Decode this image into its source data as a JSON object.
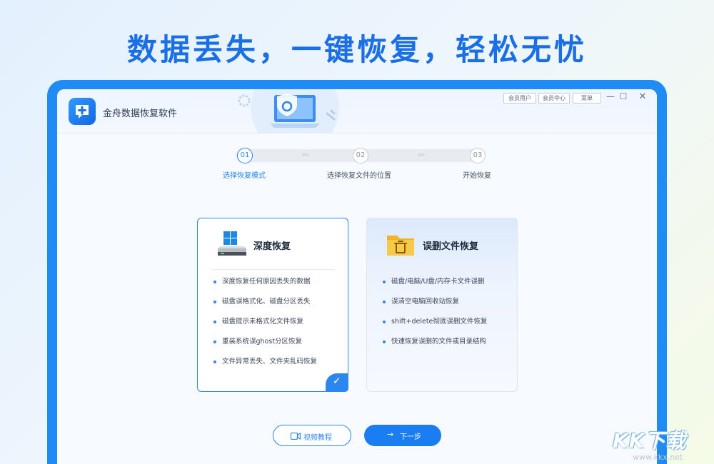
{
  "headline": "数据丢失，一键恢复，轻松无忧",
  "app": {
    "title": "金舟数据恢复软件",
    "buttons": {
      "member": "会员用户",
      "center": "会员中心",
      "menu": "菜单"
    },
    "window_controls": {
      "minimize": "—",
      "maximize": "☐",
      "close": "✕"
    }
  },
  "steps": [
    {
      "number": "01",
      "label": "选择恢复模式",
      "active": true
    },
    {
      "number": "02",
      "label": "选择恢复文件的位置",
      "active": false
    },
    {
      "number": "03",
      "label": "开始恢复",
      "active": false
    }
  ],
  "step_separator": "»",
  "cards": {
    "deep": {
      "title": "深度恢复",
      "icon": "windows-drive-icon",
      "selected": true,
      "items": [
        "深度恢复任何原因丢失的数据",
        "磁盘误格式化、磁盘分区丢失",
        "磁盘提示未格式化文件恢复",
        "重装系统误ghost分区恢复",
        "文件异常丢失、文件夹乱码恢复"
      ]
    },
    "deleted": {
      "title": "误删文件恢复",
      "icon": "folder-trash-icon",
      "selected": false,
      "items": [
        "磁盘/电脑/U盘/内存卡文件误删",
        "误清空电脑回收站恢复",
        "shift+delete彻底误删文件恢复",
        "快速恢复误删的文件或目录结构"
      ]
    }
  },
  "actions": {
    "video": "视频教程",
    "next_arrow": "→",
    "next": "下一步"
  },
  "watermark": {
    "main": "KK下载",
    "url": "www.kkx.net"
  },
  "colors": {
    "accent": "#2b86f0",
    "headline": "#1a6fe6",
    "frame": "#1f8cf6"
  }
}
